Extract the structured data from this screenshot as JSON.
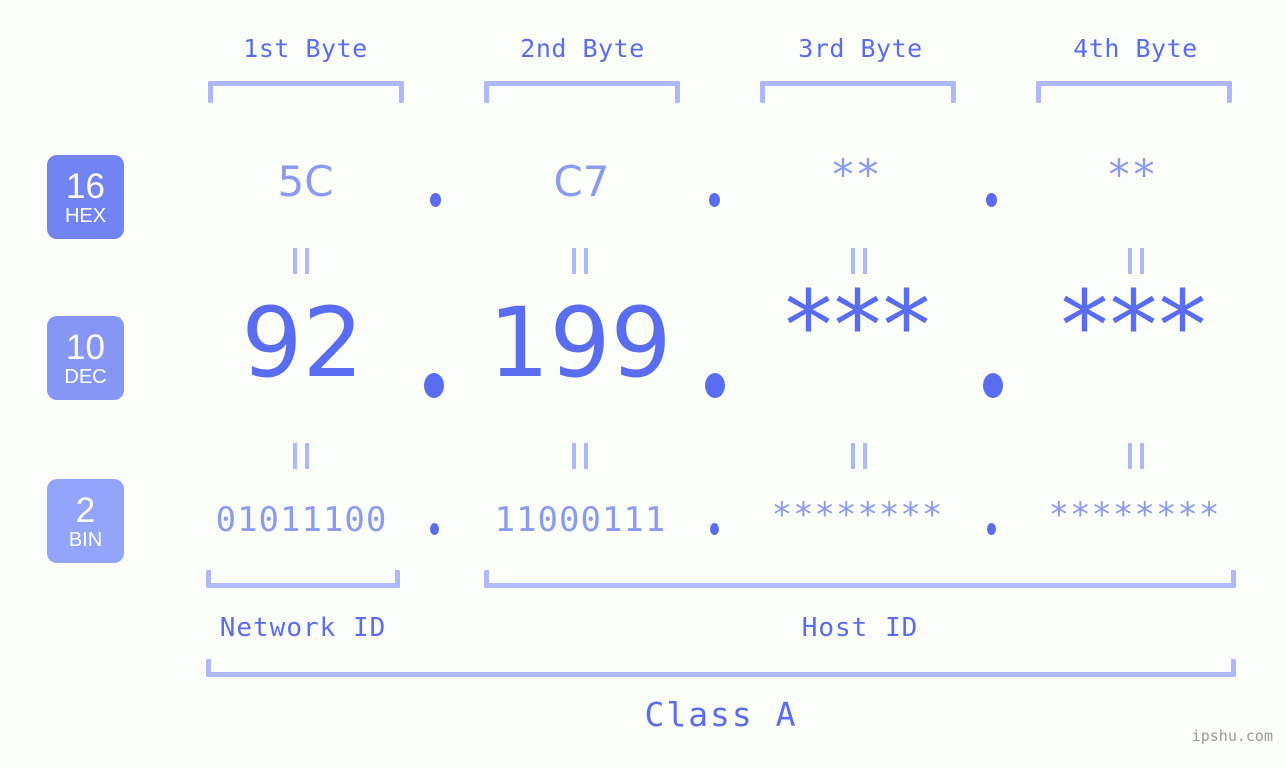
{
  "background": "#fbfdf9",
  "colors": {
    "primary": "#5a6df0",
    "light": "#8c9bf2",
    "bracket": "#aeb8fb",
    "badge_hex": "#7283f2",
    "badge_dec": "#8596f5",
    "badge_bin": "#93a5fa",
    "watermark": "#9a9a9a"
  },
  "headers": {
    "byte1": "1st Byte",
    "byte2": "2nd Byte",
    "byte3": "3rd Byte",
    "byte4": "4th Byte"
  },
  "bases": [
    {
      "number": "16",
      "unit": "HEX"
    },
    {
      "number": "10",
      "unit": "DEC"
    },
    {
      "number": "2",
      "unit": "BIN"
    }
  ],
  "rows": {
    "hex": {
      "label_number": "16",
      "label_unit": "HEX",
      "values": [
        "5C",
        "C7",
        "**",
        "**"
      ],
      "separator": "."
    },
    "dec": {
      "label_number": "10",
      "label_unit": "DEC",
      "values": [
        "92",
        "199",
        "***",
        "***"
      ],
      "separator": "."
    },
    "bin": {
      "label_number": "2",
      "label_unit": "BIN",
      "values": [
        "01011100",
        "11000111",
        "********",
        "********"
      ],
      "separator": "."
    }
  },
  "equality_marks": {
    "glyph": "=",
    "count_per_gap": 4
  },
  "segments": {
    "network_id": "Network ID",
    "host_id": "Host ID",
    "class": "Class A"
  },
  "watermark": "ipshu.com"
}
